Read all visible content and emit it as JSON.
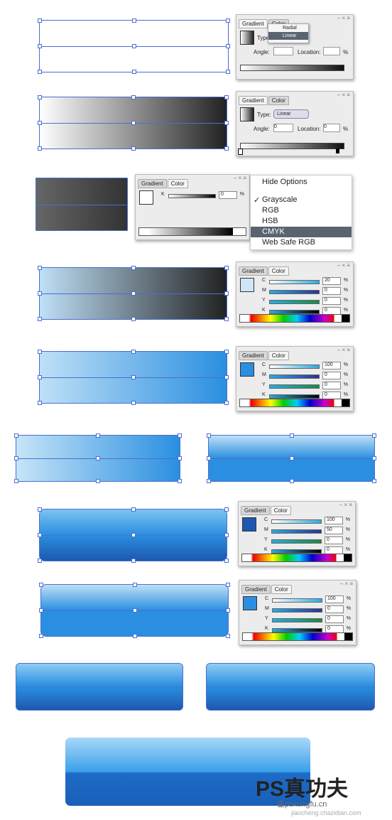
{
  "gradient_panel_1": {
    "tab_gradient": "Gradient",
    "tab_color": "Color",
    "type_label": "Type:",
    "type_value": "Linear",
    "angle_label": "Angle:",
    "location_label": "Location:",
    "percent": "%",
    "dropdown_options": [
      "Radial",
      "Linear"
    ],
    "dropdown_selected": "Linear"
  },
  "gradient_panel_2": {
    "tab_gradient": "Gradient",
    "tab_color": "Color",
    "type_label": "Type:",
    "type_value": "Linear",
    "angle_label": "Angle:",
    "angle_value": "0",
    "location_label": "Location:",
    "location_value": "0",
    "percent": "%"
  },
  "color_panel_gray": {
    "tab_gradient": "Gradient",
    "tab_color": "Color",
    "channel": "K",
    "value": "0",
    "percent": "%"
  },
  "color_mode_menu": {
    "items": [
      "Hide Options",
      "Grayscale",
      "RGB",
      "HSB",
      "CMYK",
      "Web Safe RGB"
    ],
    "checked": "Grayscale",
    "highlighted": "CMYK"
  },
  "cmyk_panels": [
    {
      "tab_gradient": "Gradient",
      "tab_color": "Color",
      "swatch": "#cfe6f8",
      "channels": [
        "C",
        "M",
        "Y",
        "K"
      ],
      "values": [
        "20",
        "0",
        "0",
        "0"
      ]
    },
    {
      "tab_gradient": "Gradient",
      "tab_color": "Color",
      "swatch": "#2a8fe0",
      "channels": [
        "C",
        "M",
        "Y",
        "K"
      ],
      "values": [
        "100",
        "0",
        "0",
        "0"
      ]
    },
    {
      "tab_gradient": "Gradient",
      "tab_color": "Color",
      "swatch": "#1d58b0",
      "channels": [
        "C",
        "M",
        "Y",
        "K"
      ],
      "values": [
        "100",
        "50",
        "0",
        "0"
      ]
    },
    {
      "tab_gradient": "Gradient",
      "tab_color": "Color",
      "swatch": "#2a8fe0",
      "channels": [
        "C",
        "M",
        "Y",
        "K"
      ],
      "values": [
        "100",
        "0",
        "0",
        "0"
      ]
    }
  ],
  "colors": {
    "selection": "#4a6fd0",
    "light_blue": "#bfe0f7",
    "blue": "#2a8fe0",
    "dark_blue": "#1d58b0"
  },
  "watermark": {
    "logo": "PS真功夫",
    "sub": "查pskungfu.cn",
    "url": "jiaocheng.chazidian.com"
  }
}
